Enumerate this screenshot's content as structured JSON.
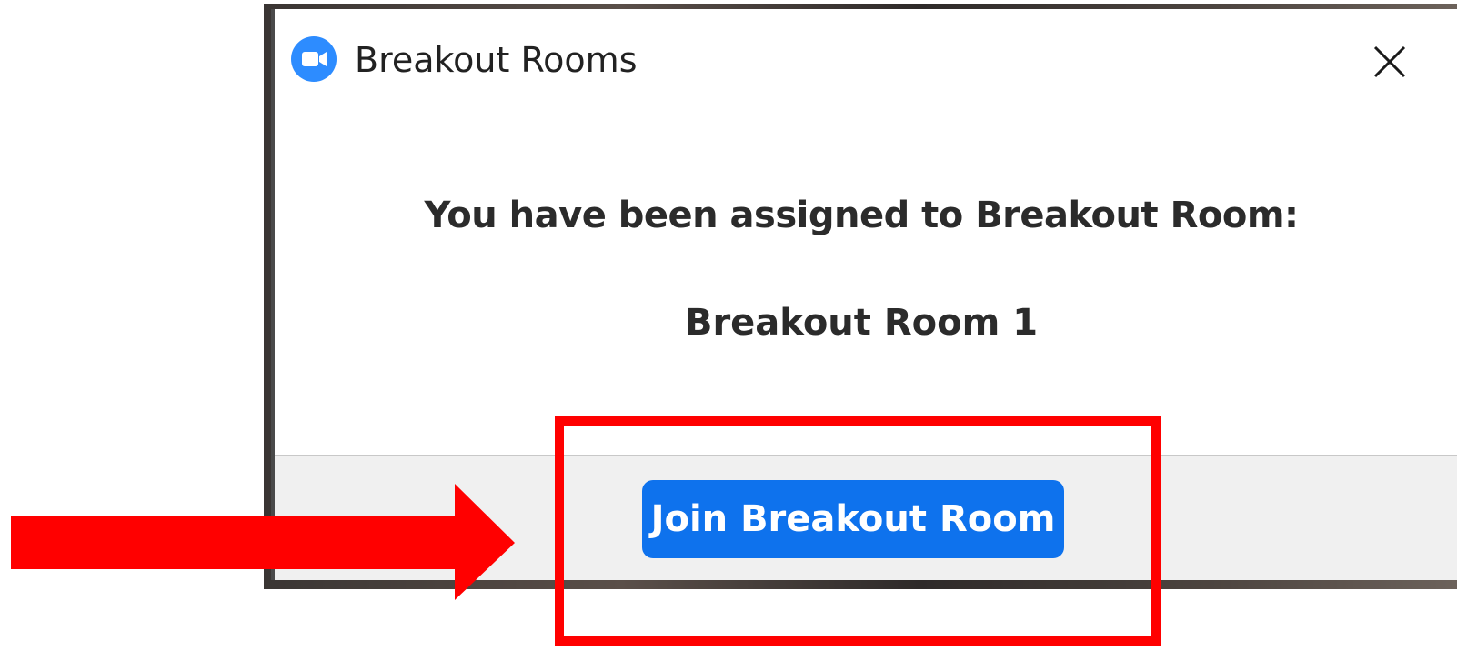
{
  "window": {
    "title": "Breakout Rooms",
    "app_icon": "zoom-camera-icon",
    "close_icon": "close-icon"
  },
  "dialog": {
    "message": "You have been assigned to Breakout Room:",
    "room_name": "Breakout Room 1",
    "join_label": "Join Breakout Room"
  },
  "annotation": {
    "arrow_icon": "arrow-right-icon",
    "color": "#ff0000"
  },
  "colors": {
    "accent": "#0e72ed",
    "app_icon": "#2d8cff",
    "footer_bg": "#f0f0f0"
  }
}
